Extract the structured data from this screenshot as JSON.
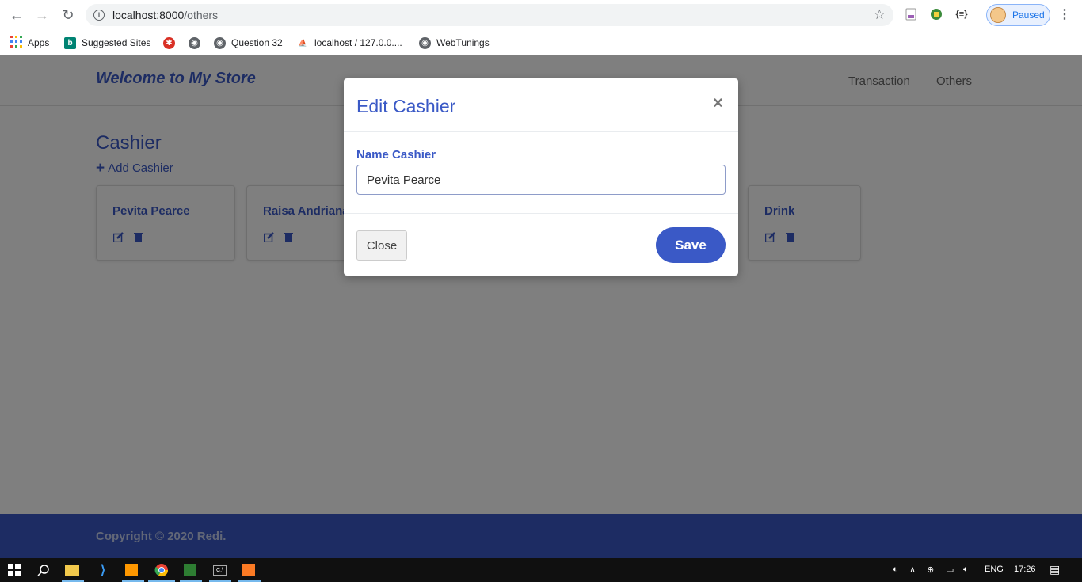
{
  "browser": {
    "url_host": "localhost:8000",
    "url_path": "/others",
    "profile_status": "Paused",
    "ext_label": "{≡}",
    "bookmarks": [
      {
        "label": "Apps",
        "icon": "apps-grid-icon"
      },
      {
        "label": "Suggested Sites",
        "icon": "bing-icon"
      },
      {
        "label": "",
        "icon": "red-badge-icon"
      },
      {
        "label": "",
        "icon": "globe-icon"
      },
      {
        "label": "Question 32",
        "icon": "globe-icon"
      },
      {
        "label": "localhost / 127.0.0....",
        "icon": "phpmyadmin-icon"
      },
      {
        "label": "WebTunings",
        "icon": "globe-icon"
      }
    ]
  },
  "navbar": {
    "brand": "Welcome to My Store",
    "links": [
      "Transaction",
      "Others"
    ]
  },
  "main": {
    "section_title": "Cashier",
    "add_label": "Add Cashier",
    "cards": [
      {
        "title": "Pevita Pearce"
      },
      {
        "title": "Raisa Andriana"
      },
      {
        "title": "Drink"
      }
    ]
  },
  "modal": {
    "title": "Edit Cashier",
    "field_label": "Name Cashier",
    "field_value": "Pevita Pearce",
    "close_label": "Close",
    "save_label": "Save"
  },
  "footer": {
    "text": "Copyright © 2020 Redi."
  },
  "taskbar": {
    "language": "ENG",
    "time": "17:26"
  },
  "colors": {
    "accent": "#3a59c6",
    "footer_bg": "#3a59c6"
  }
}
